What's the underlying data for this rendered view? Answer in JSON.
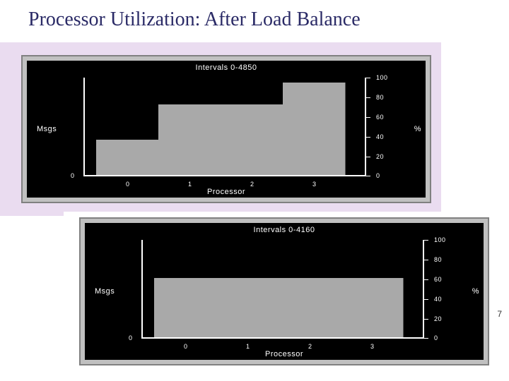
{
  "title": "Processor Utilization: After Load Balance",
  "page_number": "7",
  "chart1": {
    "interval_label": "Intervals 0-4850",
    "left_axis_label": "Msgs",
    "right_axis_label": "%",
    "x_axis_label": "Processor",
    "left_ticks": [
      "0"
    ],
    "right_ticks": [
      "100",
      "80",
      "60",
      "40",
      "20",
      "0"
    ],
    "x_ticks": [
      "0",
      "1",
      "2",
      "3"
    ]
  },
  "chart2": {
    "interval_label": "Intervals 0-4160",
    "left_axis_label": "Msgs",
    "right_axis_label": "%",
    "x_axis_label": "Processor",
    "left_ticks": [
      "0"
    ],
    "right_ticks": [
      "100",
      "80",
      "60",
      "40",
      "20",
      "0"
    ],
    "x_ticks": [
      "0",
      "1",
      "2",
      "3"
    ]
  },
  "chart_data": [
    {
      "type": "bar",
      "title": "Intervals 0-4850",
      "xlabel": "Processor",
      "ylabel": "%",
      "ylim": [
        0,
        100
      ],
      "categories": [
        "0",
        "1",
        "2",
        "3"
      ],
      "values": [
        36,
        72,
        72,
        94
      ]
    },
    {
      "type": "bar",
      "title": "Intervals 0-4160",
      "xlabel": "Processor",
      "ylabel": "%",
      "ylim": [
        0,
        100
      ],
      "categories": [
        "0",
        "1",
        "2",
        "3"
      ],
      "values": [
        60,
        60,
        60,
        60
      ]
    }
  ]
}
